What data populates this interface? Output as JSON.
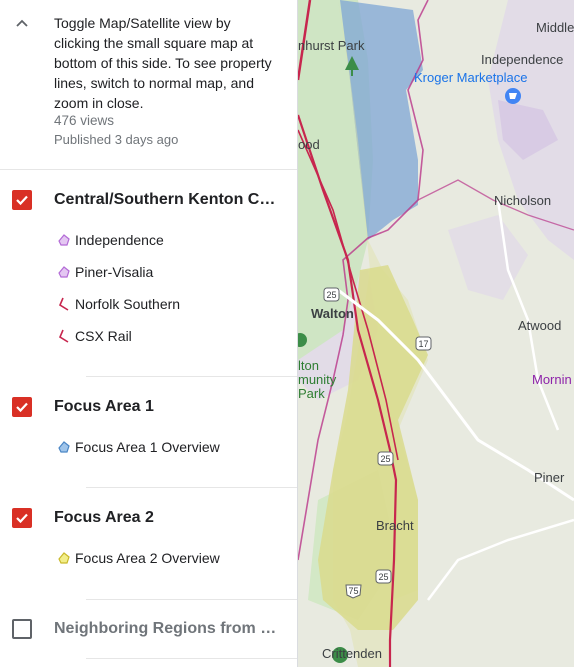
{
  "description": {
    "text": "Toggle Map/Satellite view by clicking the small square map at bottom of this side. To see property lines, switch to normal map, and zoom in close.",
    "views": "476 views",
    "published": "Published 3 days ago"
  },
  "layers": [
    {
      "title": "Central/Southern Kenton County",
      "checked": true,
      "items": [
        "Independence",
        "Piner-Visalia",
        "Norfolk Southern",
        "CSX Rail"
      ]
    },
    {
      "title": "Focus Area 1",
      "checked": true,
      "items": [
        "Focus Area 1 Overview"
      ]
    },
    {
      "title": "Focus Area 2",
      "checked": true,
      "items": [
        "Focus Area 2 Overview"
      ]
    },
    {
      "title": "Neighboring Regions from Central/Southern Kenton County",
      "checked": false,
      "items": []
    }
  ],
  "map": {
    "labels": {
      "middle": "Middle",
      "independence": "Independence",
      "kroger": "Kroger Marketplace",
      "hurst_park": "nhurst Park",
      "ood": "ood",
      "nicholson": "Nicholson",
      "walton": "Walton",
      "atwood": "Atwood",
      "morning": "Mornin",
      "lton": "lton",
      "munity": "munity",
      "park": "Park",
      "piner": "Piner",
      "bracht": "Bracht",
      "crittenden": "Crittenden"
    },
    "shields": {
      "s25a": "25",
      "s17": "17",
      "s25b": "25",
      "s25c": "25",
      "s75": "75"
    },
    "colors": {
      "focus1": "#7fa6d6",
      "focus2": "#d9da8c",
      "road": "#c7264e"
    }
  }
}
